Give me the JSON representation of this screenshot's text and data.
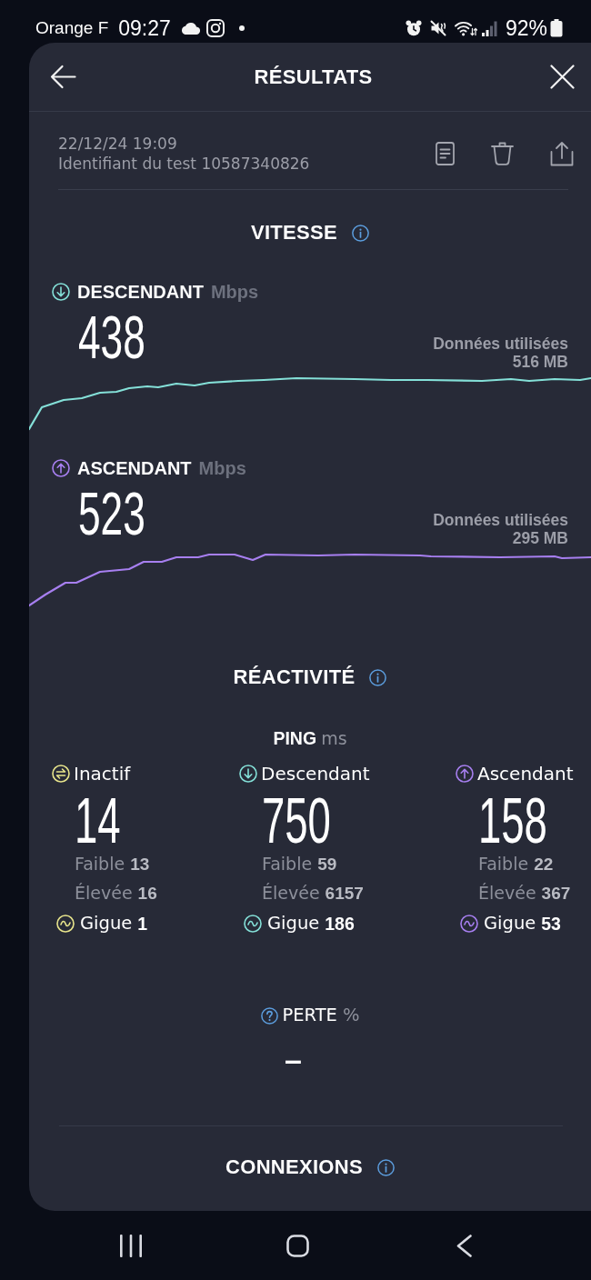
{
  "status_bar": {
    "carrier": "Orange F",
    "time": "09:27",
    "battery": "92%"
  },
  "header": {
    "title": "RÉSULTATS"
  },
  "test_info": {
    "date": "22/12/24 19:09",
    "test_id": "Identifiant du test 10587340826"
  },
  "speed": {
    "title": "VITESSE",
    "results": [
      {
        "kind": "download",
        "label": "DESCENDANT",
        "unit": "Mbps",
        "value": "438",
        "data_label": "Données utilisées",
        "data_amount": "516 MB",
        "color": "#84e0d8"
      },
      {
        "kind": "upload",
        "label": "ASCENDANT",
        "unit": "Mbps",
        "value": "523",
        "data_label": "Données utilisées",
        "data_amount": "295 MB",
        "color": "#a77ff0"
      }
    ]
  },
  "responsiveness": {
    "title": "RÉACTIVITÉ",
    "ping_label": "PING",
    "ping_unit": "ms",
    "columns": [
      {
        "kind": "idle",
        "label": "Inactif",
        "value": "14",
        "low_label": "Faible",
        "low": "13",
        "high_label": "Élevée",
        "high": "16",
        "jitter_label": "Gigue",
        "jitter": "1",
        "color": "#e8e58c"
      },
      {
        "kind": "download",
        "label": "Descendant",
        "value": "750",
        "low_label": "Faible",
        "low": "59",
        "high_label": "Élevée",
        "high": "6157",
        "jitter_label": "Gigue",
        "jitter": "186",
        "color": "#84e0d8"
      },
      {
        "kind": "upload",
        "label": "Ascendant",
        "value": "158",
        "low_label": "Faible",
        "low": "22",
        "high_label": "Élevée",
        "high": "367",
        "jitter_label": "Gigue",
        "jitter": "53",
        "color": "#a77ff0"
      }
    ]
  },
  "packet_loss": {
    "label": "PERTE",
    "unit": "%",
    "value": "–"
  },
  "connections": {
    "title": "CONNEXIONS"
  }
}
